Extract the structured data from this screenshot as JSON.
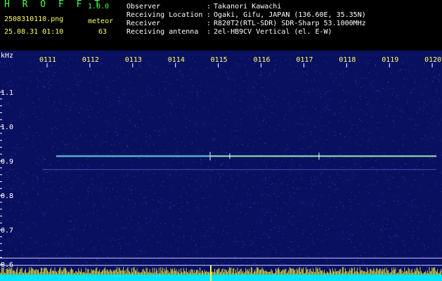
{
  "header": {
    "app_title": "H R O F F T",
    "app_version": "1.0.0",
    "filename": "2508310110.png",
    "meteor_label": "meteor",
    "datetime": "25.08.31 01:10",
    "meteor_count": "63",
    "info": [
      {
        "key": "Observer",
        "value": "Takanori Kawachi"
      },
      {
        "key": "Receiving Location",
        "value": "Ogaki, Gifu, JAPAN (136.60E, 35.35N)"
      },
      {
        "key": "Receiver",
        "value": "R820T2(RTL-SDR) SDR-Sharp 53.1000MHz"
      },
      {
        "key": "Receiving antenna",
        "value": "2el-HB9CV Vertical (el. E-W)"
      }
    ]
  },
  "spectrogram": {
    "y_unit": "kHz",
    "y_ticks": [
      "1.1",
      "1.0",
      "0.9",
      "0.8",
      "0.7",
      "0.6"
    ],
    "y_tick_values": [
      1.1,
      1.0,
      0.9,
      0.8,
      0.7,
      0.6
    ],
    "time_labels": [
      "0111",
      "0112",
      "0113",
      "0114",
      "0115",
      "0116",
      "0117",
      "0118",
      "0119",
      "0120"
    ],
    "y_range": [
      1.2,
      0.58
    ],
    "colors": {
      "background": "#0a1060",
      "noise": "#3e52c8",
      "carrier": "#5fe0e0",
      "carrier_core": "#e8e870",
      "baseline": "#c8c8ff",
      "ticks": "#ffffff",
      "bottom_trace": "#00e5ff",
      "bottom_spikes": "#ffff40"
    }
  }
}
